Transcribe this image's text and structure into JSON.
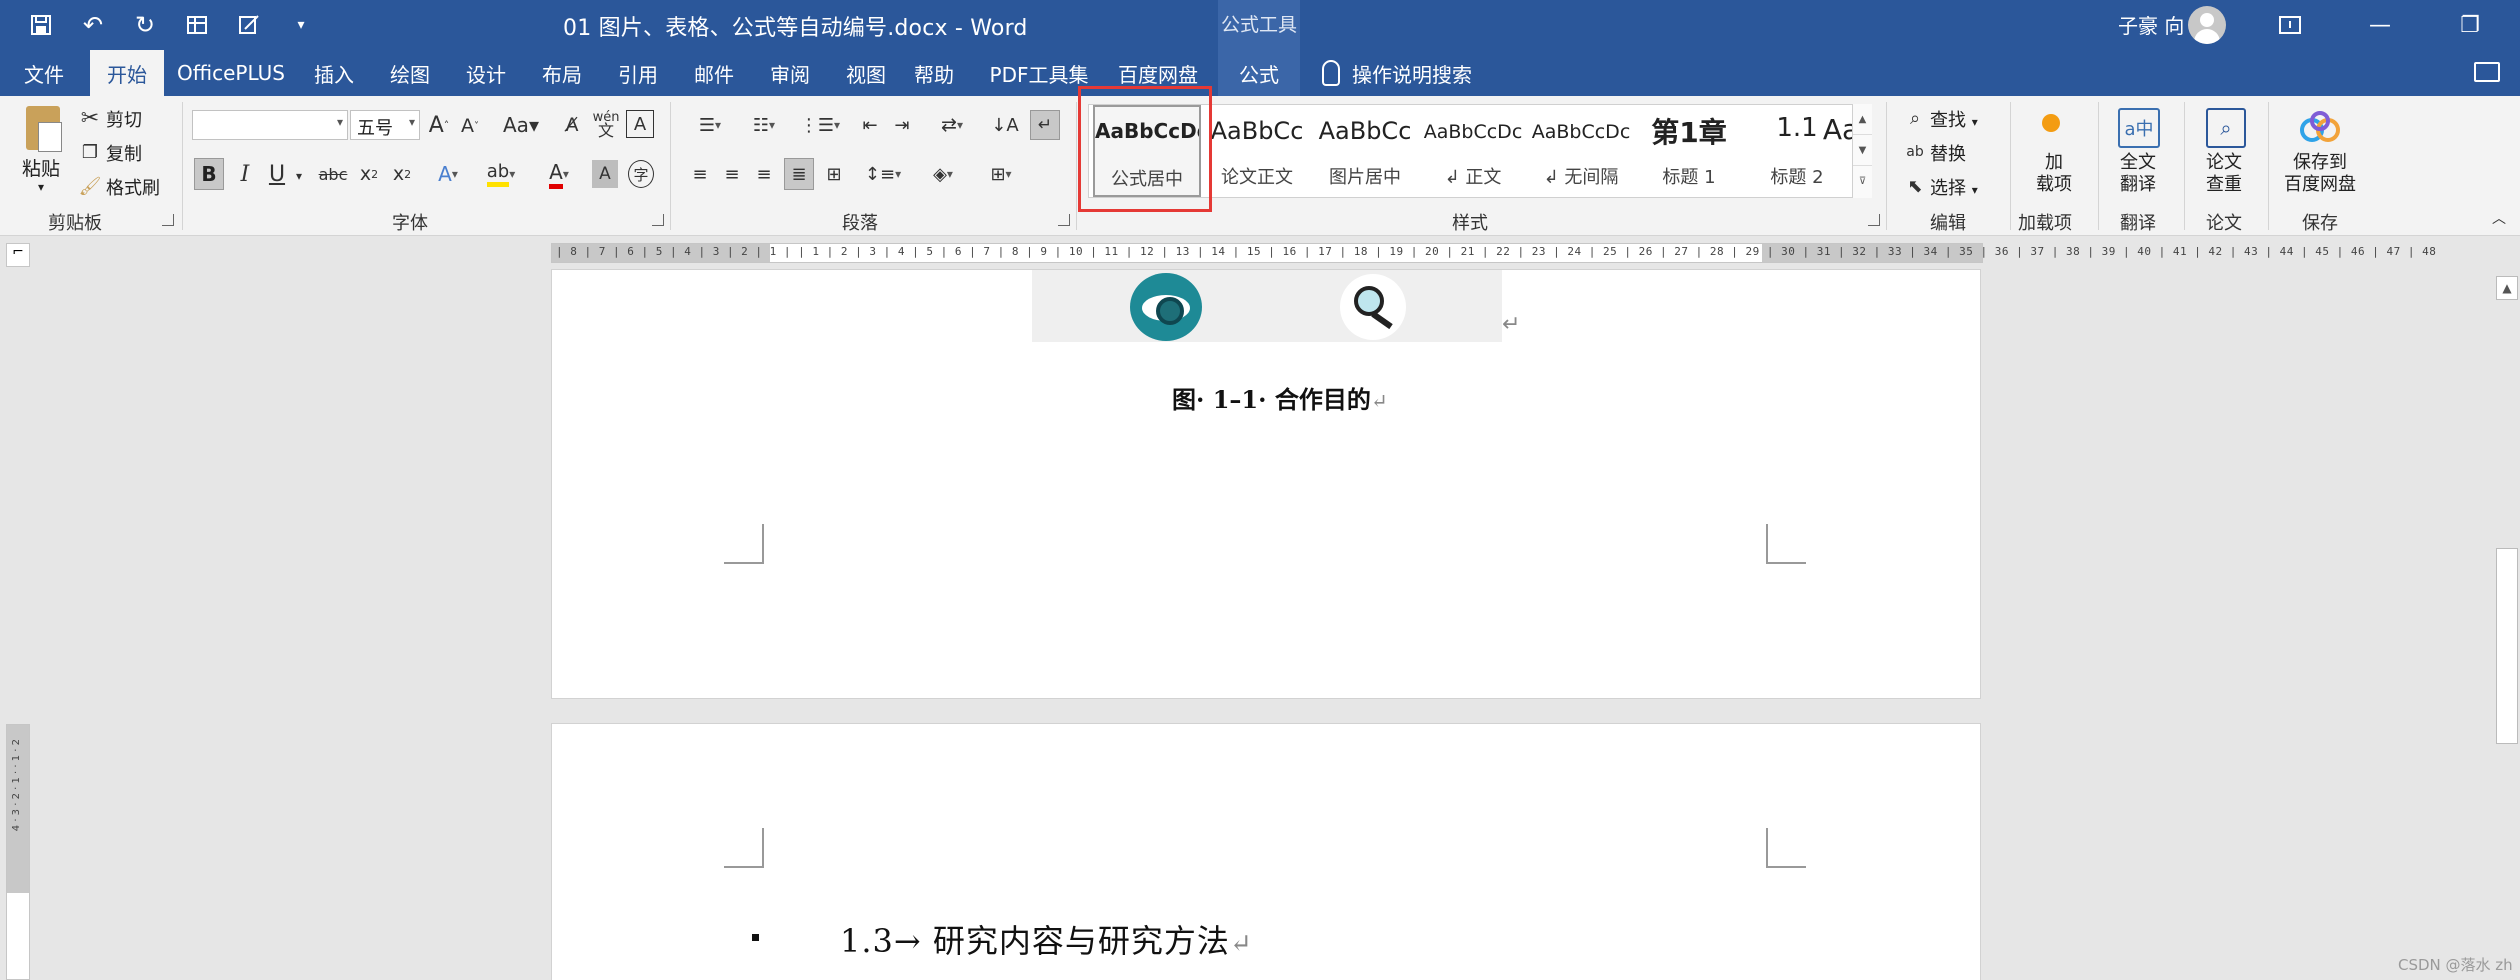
{
  "window": {
    "doc_title": "01 图片、表格、公式等自动编号.docx  -  Word",
    "contextual_tools": "公式工具",
    "user_name": "子豪 向"
  },
  "tabs": [
    {
      "label": "文件"
    },
    {
      "label": "开始"
    },
    {
      "label": "OfficePLUS"
    },
    {
      "label": "插入"
    },
    {
      "label": "绘图"
    },
    {
      "label": "设计"
    },
    {
      "label": "布局"
    },
    {
      "label": "引用"
    },
    {
      "label": "邮件"
    },
    {
      "label": "审阅"
    },
    {
      "label": "视图"
    },
    {
      "label": "帮助"
    },
    {
      "label": "PDF工具集"
    },
    {
      "label": "百度网盘"
    },
    {
      "label": "公式"
    }
  ],
  "tell_me": "操作说明搜索",
  "ribbon": {
    "clipboard": {
      "paste": "粘贴",
      "cut": "剪切",
      "copy": "复制",
      "format_painter": "格式刷",
      "group": "剪贴板"
    },
    "font": {
      "font_name": "",
      "font_size": "五号",
      "group": "字体"
    },
    "paragraph": {
      "group": "段落"
    },
    "styles": {
      "group": "样式",
      "items": [
        {
          "sample": "AaBbCcDd",
          "name": "公式居中"
        },
        {
          "sample": "AaBbCc",
          "name": "论文正文"
        },
        {
          "sample": "AaBbCc",
          "name": "图片居中"
        },
        {
          "sample": "AaBbCcDc",
          "name": "↲ 正文"
        },
        {
          "sample": "AaBbCcDc",
          "name": "↲ 无间隔"
        },
        {
          "sample": "第1章",
          "name": "标题 1"
        },
        {
          "sample": "1.1",
          "name": "标题 2"
        },
        {
          "sample": "Aa",
          "name": ""
        }
      ]
    },
    "editing": {
      "find": "查找",
      "replace": "替换",
      "select": "选择",
      "group": "编辑"
    },
    "addins": {
      "label": "加\n载项",
      "group": "加载项"
    },
    "translate": {
      "label": "全文\n翻译",
      "group": "翻译"
    },
    "paper": {
      "label": "论文\n查重",
      "group": "论文"
    },
    "save": {
      "label": "保存到\n百度网盘",
      "group": "保存"
    }
  },
  "ruler": {
    "numbers": "| 8 | 7 | 6 | 5 | 4 | 3 | 2 | 1 |   | 1 | 2 | 3 | 4 | 5 | 6 | 7 | 8 | 9 | 10 | 11 | 12 | 13 | 14 | 15 | 16 | 17 | 18 | 19 | 20 | 21 | 22 | 23 | 24 | 25 | 26 | 27 | 28 | 29 | 30 | 31 | 32 | 33 | 34 | 35 | 36 | 37 | 38 | 39 | 40 | 41 | 42 | 43 | 44 | 45 | 46 | 47 | 48"
  },
  "vertical_ruler": {
    "numbers": "4 · 3 · 2 · 1 ·   · 1 · 2"
  },
  "document": {
    "caption": "图· 1–1· 合作目的",
    "heading": "1.3→ 研究内容与研究方法",
    "return_mark": "↵"
  },
  "watermark": "CSDN @落水 zh"
}
